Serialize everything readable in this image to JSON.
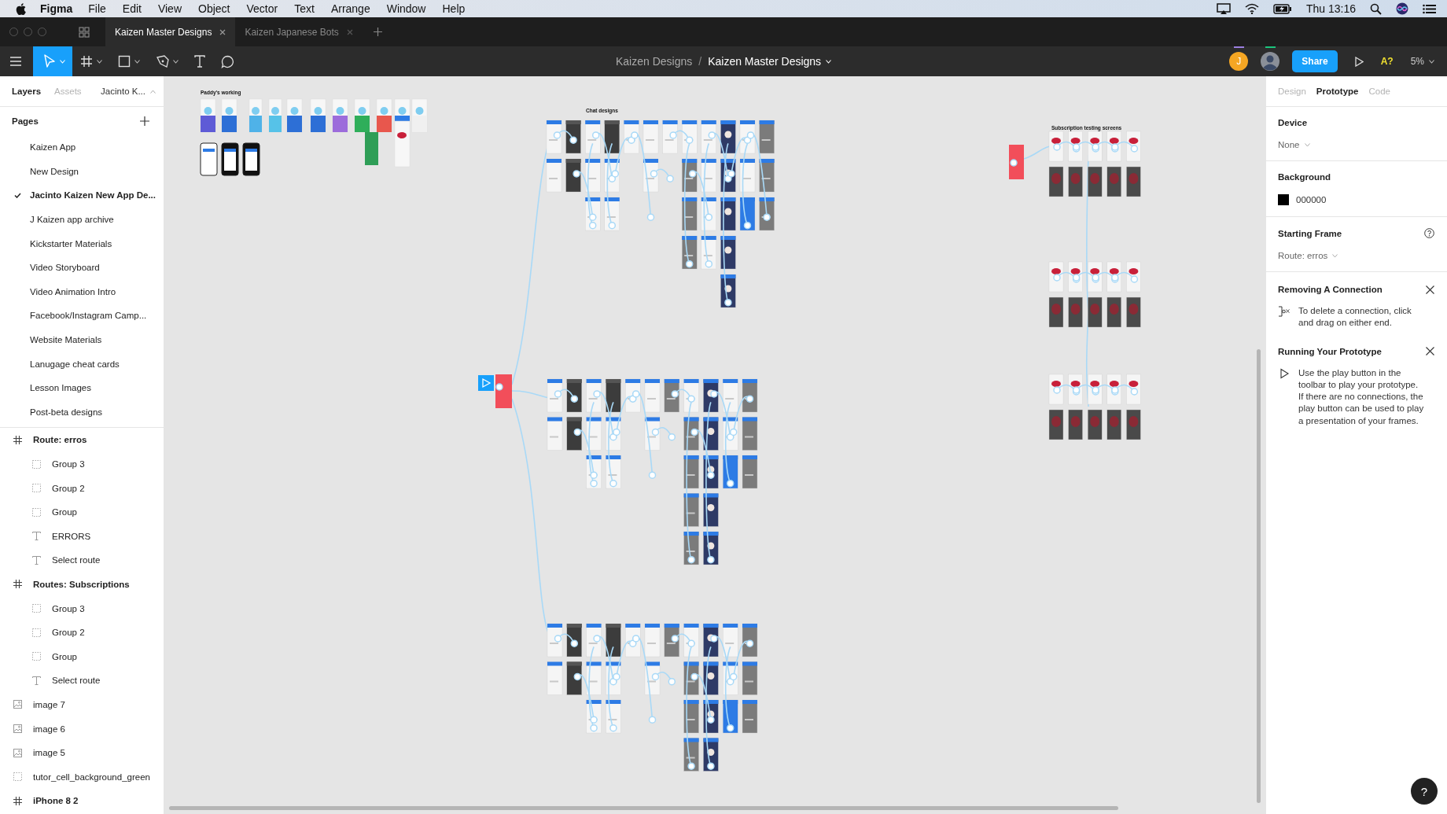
{
  "menu_bar": {
    "app": "Figma",
    "items": [
      "File",
      "Edit",
      "View",
      "Object",
      "Vector",
      "Text",
      "Arrange",
      "Window",
      "Help"
    ],
    "clock": "Thu 13:16"
  },
  "tabs": [
    {
      "label": "Kaizen Master Designs",
      "selected": true
    },
    {
      "label": "Kaizen Japanese Bots",
      "selected": false
    }
  ],
  "toolbar": {
    "tools": [
      {
        "kind": "move",
        "selected": true,
        "caret": true
      },
      {
        "kind": "frame",
        "selected": false,
        "caret": true
      },
      {
        "kind": "shape",
        "selected": false,
        "caret": true
      },
      {
        "kind": "pen",
        "selected": false,
        "caret": true
      },
      {
        "kind": "text",
        "selected": false,
        "caret": false
      },
      {
        "kind": "comment",
        "selected": false,
        "caret": false
      }
    ],
    "breadcrumb": {
      "team": "Kaizen Designs",
      "separator": "/",
      "file": "Kaizen Master Designs"
    },
    "collaborators": [
      {
        "kind": "initial",
        "initial": "J",
        "color": "#9b7fe0"
      },
      {
        "kind": "photo",
        "color": "#1bc47d"
      }
    ],
    "share": "Share",
    "font_warning": "A?",
    "zoom": "5%"
  },
  "left_panel": {
    "tabs": [
      {
        "label": "Layers",
        "selected": true
      },
      {
        "label": "Assets",
        "selected": false
      }
    ],
    "page_picker": "Jacinto K...",
    "pages_title": "Pages",
    "pages": [
      {
        "name": "Kaizen App",
        "selected": false
      },
      {
        "name": "New Design",
        "selected": false
      },
      {
        "name": "Jacinto Kaizen New App De...",
        "selected": true
      },
      {
        "name": "J Kaizen app archive",
        "selected": false
      },
      {
        "name": "Kickstarter Materials",
        "selected": false
      },
      {
        "name": "Video Storyboard",
        "selected": false
      },
      {
        "name": "Video Animation Intro",
        "selected": false
      },
      {
        "name": "Facebook/Instagram Camp...",
        "selected": false
      },
      {
        "name": "Website Materials",
        "selected": false
      },
      {
        "name": "Lanugage cheat cards",
        "selected": false
      },
      {
        "name": "Lesson Images",
        "selected": false
      },
      {
        "name": "Post-beta designs",
        "selected": false
      }
    ],
    "layers": [
      {
        "kind": "frame",
        "name": "Route: erros",
        "children": [
          {
            "kind": "group",
            "name": "Group 3"
          },
          {
            "kind": "group",
            "name": "Group 2"
          },
          {
            "kind": "group",
            "name": "Group"
          },
          {
            "kind": "text",
            "name": "ERRORS"
          },
          {
            "kind": "text",
            "name": "Select route"
          }
        ]
      },
      {
        "kind": "frame",
        "name": "Routes: Subscriptions",
        "children": [
          {
            "kind": "group",
            "name": "Group 3"
          },
          {
            "kind": "group",
            "name": "Group 2"
          },
          {
            "kind": "group",
            "name": "Group"
          },
          {
            "kind": "text",
            "name": "Select route"
          }
        ]
      },
      {
        "kind": "image",
        "name": "image 7"
      },
      {
        "kind": "image",
        "name": "image 6"
      },
      {
        "kind": "image",
        "name": "image 5"
      },
      {
        "kind": "group",
        "name": "tutor_cell_background_green"
      },
      {
        "kind": "frame",
        "name": "iPhone 8 2"
      }
    ]
  },
  "canvas": {
    "labels": [
      "Paddy's working",
      "Chat designs",
      "Subscription testing screens"
    ]
  },
  "right_panel": {
    "tabs": [
      {
        "label": "Design",
        "selected": false
      },
      {
        "label": "Prototype",
        "selected": true
      },
      {
        "label": "Code",
        "selected": false
      }
    ],
    "device": {
      "title": "Device",
      "value": "None"
    },
    "background": {
      "title": "Background",
      "hex": "000000"
    },
    "starting_frame": {
      "title": "Starting Frame",
      "value": "Route: erros"
    },
    "tips": [
      {
        "kind": "connection",
        "title": "Removing A Connection",
        "body": "To delete a connection, click and drag on either end."
      },
      {
        "kind": "play",
        "title": "Running Your Prototype",
        "body": "Use the play button in the toolbar to play your prototype. If there are no connections, the play button can be used to play a presentation of your frames."
      }
    ]
  },
  "help_button": "?"
}
